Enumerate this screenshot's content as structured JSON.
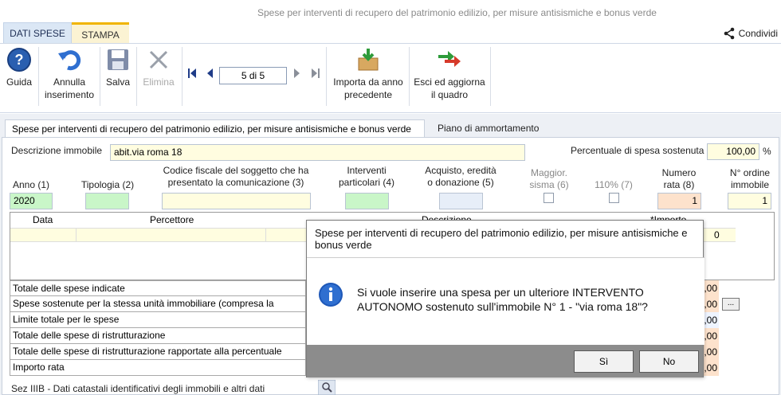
{
  "app": {
    "title": "Spese per interventi di recupero del patrimonio edilizio, per misure antisismiche e bonus verde",
    "tabs": [
      "DATI SPESE",
      "STAMPA"
    ],
    "share_label": "Condividi"
  },
  "ribbon": {
    "guida": "Guida",
    "annulla": [
      "Annulla",
      "inserimento"
    ],
    "salva": "Salva",
    "elimina": "Elimina",
    "record": "5 di 5",
    "importa": [
      "Importa da anno",
      "precedente"
    ],
    "esci": [
      "Esci ed aggiorna",
      "il quadro"
    ]
  },
  "main": {
    "tabs": [
      "Spese per interventi di recupero del patrimonio edilizio, per misure antisismiche e bonus verde",
      "Piano di ammortamento"
    ]
  },
  "form": {
    "descrizione_label": "Descrizione immobile",
    "descrizione_value": "abit.via roma 18",
    "percentuale_label": "Percentuale di spesa sostenuta",
    "percentuale_value": "100,00",
    "percent_sign": "%",
    "anno_label": "Anno (1)",
    "anno_value": "2020",
    "tipologia_label": "Tipologia (2)",
    "cf_label": [
      "Codice fiscale del soggetto che ha",
      "presentato la comunicazione (3)"
    ],
    "interventi_label": [
      "Interventi",
      "particolari (4)"
    ],
    "acquisto_label": [
      "Acquisto, eredità",
      "o donazione (5)"
    ],
    "maggior_label": [
      "Maggior.",
      "sisma (6)"
    ],
    "p110_label": "110% (7)",
    "numero_rata_label": [
      "Numero",
      "rata (8)"
    ],
    "numero_rata_value": "1",
    "ordine_label": [
      "N° ordine",
      "immobile"
    ],
    "ordine_value": "1"
  },
  "grid": {
    "headers": [
      "Data",
      "Percettore",
      "Descrizione",
      "*Importo"
    ],
    "first_row_amount": "0"
  },
  "totals": [
    {
      "label": "Totale delle spese indicate",
      "value": ",00"
    },
    {
      "label": "Spese sostenute per la stessa unità immobiliare (compresa la corrente)",
      "value": ",00"
    },
    {
      "label": "Limite totale per le spese",
      "value": ",00"
    },
    {
      "label": "Totale delle spese di ristrutturazione",
      "value": ",00"
    },
    {
      "label": "Totale delle spese di ristrutturazione rapportate alla percentuale",
      "value": ",00"
    },
    {
      "label": "Importo rata",
      "value": ",00"
    }
  ],
  "ellipsis": "...",
  "section_footer": "Sez IIIB - Dati catastali identificativi degli immobili e altri dati",
  "dialog": {
    "title": "Spese per interventi di recupero del patrimonio edilizio, per misure antisismiche e bonus verde",
    "message": "Si vuole inserire una spesa per un ulteriore INTERVENTO AUTONOMO sostenuto sull'immobile N° 1 - \"via roma 18\"?",
    "yes": "Sì",
    "no": "No"
  }
}
